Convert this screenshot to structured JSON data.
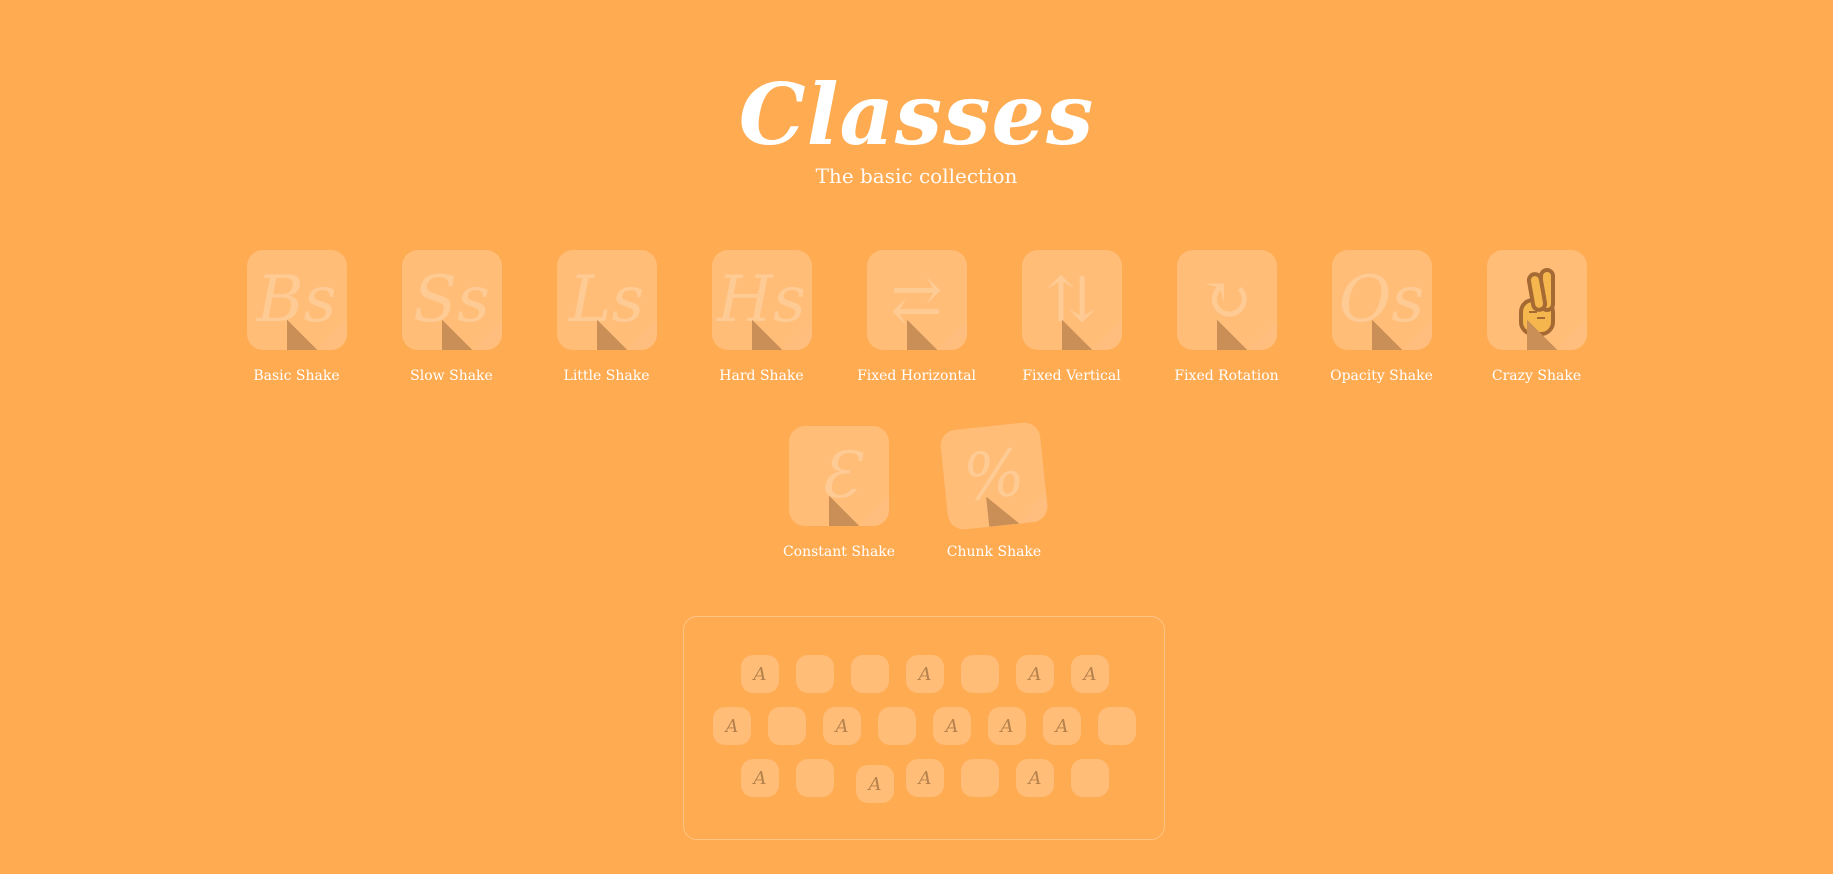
{
  "header": {
    "title": "Classes",
    "subtitle": "The basic collection"
  },
  "tiles_row1": [
    {
      "glyph": "Bs",
      "label": "Basic Shake"
    },
    {
      "glyph": "Ss",
      "label": "Slow Shake"
    },
    {
      "glyph": "Ls",
      "label": "Little Shake"
    },
    {
      "glyph": "Hs",
      "label": "Hard Shake"
    },
    {
      "glyph": "⇄",
      "label": "Fixed Horizontal"
    },
    {
      "glyph": "⇅",
      "label": "Fixed Vertical"
    },
    {
      "glyph": "↻",
      "label": "Fixed Rotation"
    },
    {
      "glyph": "Os",
      "label": "Opacity Shake"
    },
    {
      "glyph": "✌",
      "label": "Crazy Shake"
    }
  ],
  "tiles_row2": [
    {
      "glyph": "Ɛ",
      "label": "Constant Shake"
    },
    {
      "glyph": "%",
      "label": "Chunk Shake"
    }
  ],
  "keyboard": {
    "key_letter": "A"
  },
  "colors": {
    "background": "#ffab52",
    "tile": "rgba(255,255,255,0.22)"
  }
}
